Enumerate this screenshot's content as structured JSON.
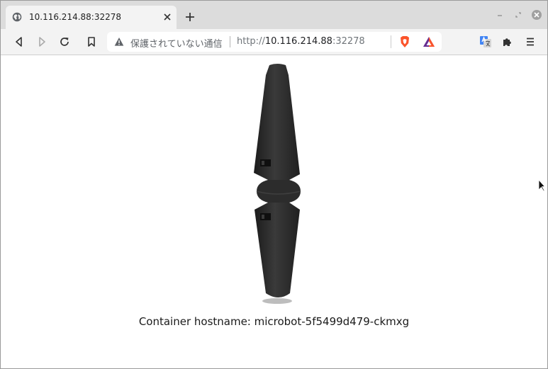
{
  "browser": {
    "tab": {
      "title": "10.116.214.88:32278"
    },
    "address_bar": {
      "security_label": "保護されていない通信",
      "url_scheme": "http://",
      "url_host": "10.116.214.88",
      "url_port": ":32278"
    }
  },
  "page": {
    "hostname_text": "Container hostname: microbot-5f5499d479-ckmxg"
  },
  "colors": {
    "tab_strip": "#dcdcdc",
    "toolbar": "#f3f3f3",
    "robot": "#2a2a2a",
    "brave_orange": "#fb542b",
    "bat_purple": "#662d91"
  }
}
